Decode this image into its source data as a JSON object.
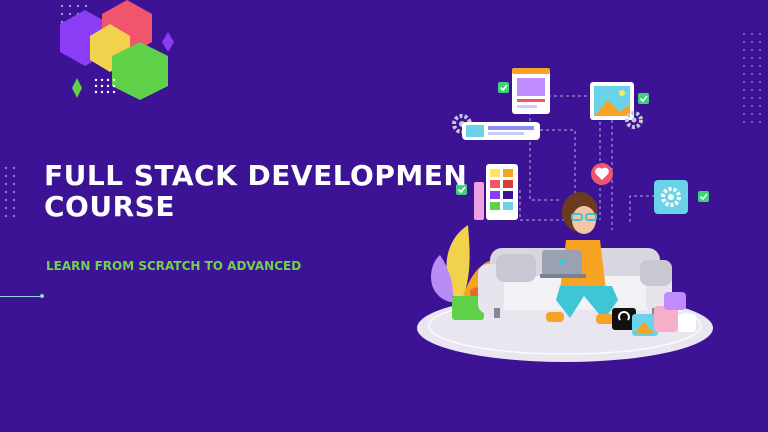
{
  "headline": {
    "line1": "FULL STACK DEVELOPMEN",
    "line2": "COURSE"
  },
  "tagline": "LEARN FROM SCRATCH TO ADVANCED",
  "colors": {
    "background": "#3d1396",
    "headline": "#ffffff",
    "tagline": "#6fd34b",
    "accent_green": "#5fd149",
    "accent_pink": "#f0556e",
    "accent_yellow": "#f2d14c",
    "accent_violet": "#8b3cf5",
    "accent_orange": "#f7a323"
  },
  "icons": [
    "hexagon-logo",
    "gear-icon",
    "image-icon",
    "heart-icon",
    "check-icon",
    "laptop-icon",
    "plant-icon",
    "sofa-icon"
  ]
}
